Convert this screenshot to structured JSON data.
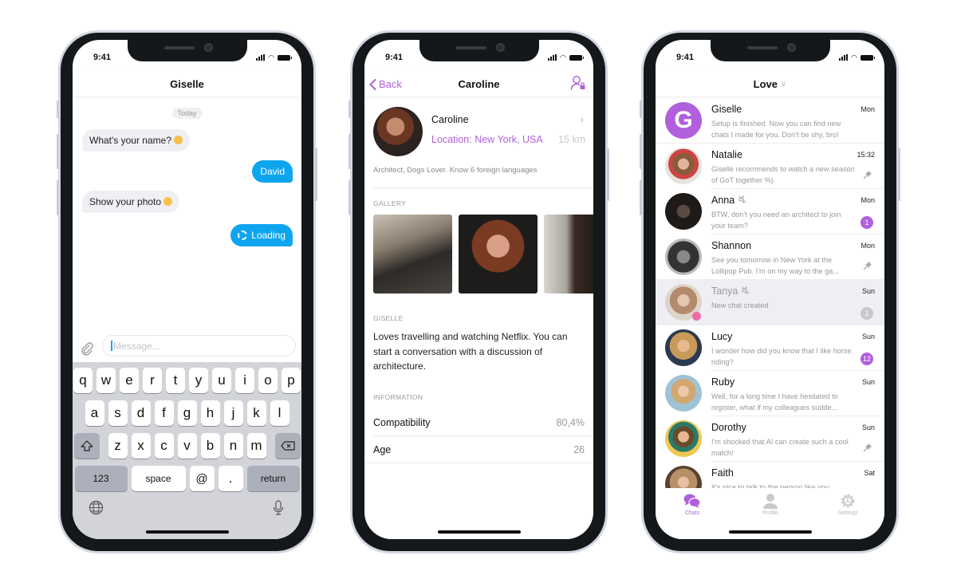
{
  "status_bar": {
    "time": "9:41"
  },
  "colors": {
    "accent": "#b15fdc",
    "bubble_out": "#0ea5ef",
    "online": "#f06aa6"
  },
  "chat_screen": {
    "title": "Giselle",
    "date_label": "Today",
    "messages": [
      {
        "direction": "in",
        "text": "What's your name?",
        "emoji": "relieved-face"
      },
      {
        "direction": "out",
        "text": "David"
      },
      {
        "direction": "in",
        "text": "Show your photo",
        "emoji": "relieved-face"
      },
      {
        "direction": "out",
        "text": "Loading",
        "icon": "spinner-icon"
      }
    ],
    "composer": {
      "placeholder": "Message...",
      "attach_icon": "paperclip-icon"
    },
    "keyboard": {
      "row1": [
        "q",
        "w",
        "e",
        "r",
        "t",
        "y",
        "u",
        "i",
        "o",
        "p"
      ],
      "row2": [
        "a",
        "s",
        "d",
        "f",
        "g",
        "h",
        "j",
        "k",
        "l"
      ],
      "row3": [
        "z",
        "x",
        "c",
        "v",
        "b",
        "n",
        "m"
      ],
      "shift_icon": "shift-icon",
      "delete_icon": "backspace-icon",
      "numbers_label": "123",
      "space_label": "space",
      "at_label": "@",
      "dot_label": ".",
      "return_label": "return",
      "globe_icon": "globe-icon",
      "mic_icon": "microphone-icon"
    }
  },
  "profile_screen": {
    "back_label": "Back",
    "title": "Caroline",
    "nav_icon": "user-lock-icon",
    "name": "Caroline",
    "location": "Location: New York, USA",
    "distance": "15 km",
    "bio": "Architect, Dogs Lover. Know 6 foreign languages",
    "gallery_label": "GALLERY",
    "gallery_count_visible": 3,
    "about_label": "GISELLE",
    "about_text": "Loves travelling and watching Netflix. You can start a conversation with a discussion of architecture.",
    "information_label": "INFORMATION",
    "info": [
      {
        "label": "Compatibility",
        "value": "80,4%"
      },
      {
        "label": "Age",
        "value": "26"
      }
    ]
  },
  "list_screen": {
    "title": "Love",
    "chats": [
      {
        "name": "Giselle",
        "preview": "Setup is finished. Now you can find new chats I made for you. Don’t be shy, bro!",
        "time": "Mon",
        "avatar_letter": "G"
      },
      {
        "name": "Natalie",
        "preview": "Giselle recommends to watch a new season of GoT together %)",
        "time": "15:32",
        "pinned": true
      },
      {
        "name": "Anna",
        "preview": "BTW, don’t you need an architect to join your team?",
        "time": "Mon",
        "muted": true,
        "badge": "1"
      },
      {
        "name": "Shannon",
        "preview": "See you tomorrow in New York at the Lollipop Pub. I'm on my way to the ga...",
        "time": "Mon",
        "pinned": true
      },
      {
        "name": "Tanya",
        "preview": "New chat created",
        "time": "Sun",
        "muted": true,
        "badge": "1",
        "selected": true,
        "online": true
      },
      {
        "name": "Lucy",
        "preview": "I wonder how did you know that I like horse riding?",
        "time": "Sun",
        "badge": "12"
      },
      {
        "name": "Ruby",
        "preview": "Well, for a long time I have hesitated to register, what if my colleagues sudde...",
        "time": "Sun"
      },
      {
        "name": "Dorothy",
        "preview": "I'm shocked that AI can create such a cool match!",
        "time": "Sun",
        "pinned": true
      },
      {
        "name": "Faith",
        "preview": "It’s nice to talk to the person like you...",
        "time": "Sat"
      }
    ],
    "tabs": [
      {
        "label": "Chats",
        "icon": "chat-bubbles-icon",
        "active": true
      },
      {
        "label": "Profile",
        "icon": "person-icon"
      },
      {
        "label": "Settings",
        "icon": "gear-icon"
      }
    ]
  }
}
